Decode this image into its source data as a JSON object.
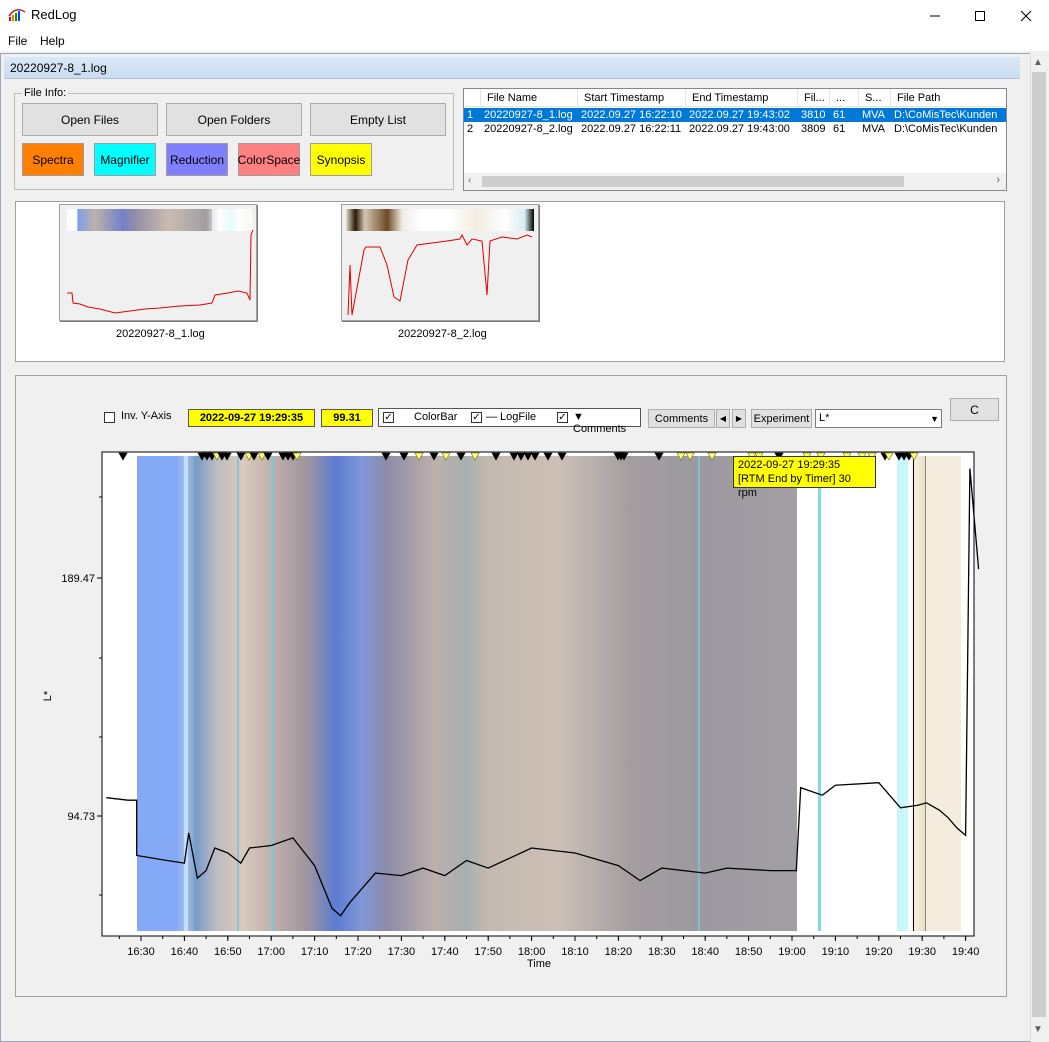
{
  "window": {
    "title": "RedLog",
    "minimize_icon": "minimize-icon",
    "maximize_icon": "maximize-icon",
    "close_icon": "close-icon"
  },
  "menu": {
    "file": "File",
    "help": "Help"
  },
  "document": {
    "title": "20220927-8_1.log"
  },
  "file_info": {
    "label": "File Info:",
    "open_files": "Open Files",
    "open_folders": "Open Folders",
    "empty_list": "Empty List"
  },
  "modes": [
    {
      "label": "Spectra",
      "color": "#ff7f00"
    },
    {
      "label": "Magnifier",
      "color": "#00ffff"
    },
    {
      "label": "Reduction",
      "color": "#8080ff"
    },
    {
      "label": "ColorSpace",
      "color": "#ff8080"
    },
    {
      "label": "Synopsis",
      "color": "#ffff00"
    }
  ],
  "file_list": {
    "columns": [
      "",
      "File Name",
      "Start Timestamp",
      "End Timestamp",
      "Fil...",
      "...",
      "S...",
      "File Path"
    ],
    "rows": [
      [
        "1",
        "20220927-8_1.log",
        "2022.09.27 16:22:10",
        "2022.09.27 19:43:02",
        "3810",
        "61",
        "MVA",
        "D:\\CoMisTec\\Kunden"
      ],
      [
        "2",
        "20220927-8_2.log",
        "2022.09.27 16:22:11",
        "2022.09.27 19:43:00",
        "3809",
        "61",
        "MVA",
        "D:\\CoMisTec\\Kunden"
      ]
    ],
    "selected_row": 0
  },
  "thumbnails": [
    {
      "label": "20220927-8_1.log"
    },
    {
      "label": "20220927-8_2.log"
    }
  ],
  "graph_controls": {
    "inv_y_axis": "Inv. Y-Axis",
    "inv_y_axis_checked": false,
    "cursor_time": "2022-09-27 19:29:35",
    "cursor_value": "99.31",
    "colorbar": "ColorBar",
    "colorbar_checked": true,
    "logfile": "— LogFile",
    "logfile_checked": true,
    "comments_opt": "▼ Comments",
    "comments_checked": true,
    "comments_button": "Comments",
    "experiment_button": "Experiment",
    "channel": "L*",
    "c_button": "C"
  },
  "tooltip": {
    "line1": "2022-09-27 19:29:35",
    "line2": "[RTM End by Timer] 30 rpm"
  },
  "chart_data": {
    "type": "line",
    "xlabel": "Time",
    "ylabel": "L*",
    "x_ticks": [
      "16:30",
      "16:40",
      "16:50",
      "17:00",
      "17:10",
      "17:20",
      "17:30",
      "17:40",
      "17:50",
      "18:00",
      "18:10",
      "18:20",
      "18:30",
      "18:40",
      "18:50",
      "19:00",
      "19:10",
      "19:20",
      "19:30",
      "19:40"
    ],
    "y_ticks": [
      "189.47",
      "94.73"
    ],
    "series": [
      {
        "color": "#000000",
        "points": [
          [
            "16:22",
            102
          ],
          [
            "16:27",
            101
          ],
          [
            "16:29",
            101
          ],
          [
            "16:29",
            79
          ],
          [
            "16:36",
            77
          ],
          [
            "16:40",
            76
          ],
          [
            "16:41",
            88
          ],
          [
            "16:43",
            70
          ],
          [
            "16:45",
            73
          ],
          [
            "16:47",
            82
          ],
          [
            "16:50",
            80
          ],
          [
            "16:53",
            76
          ],
          [
            "16:55",
            82
          ],
          [
            "17:00",
            83
          ],
          [
            "17:05",
            86
          ],
          [
            "17:10",
            75
          ],
          [
            "17:14",
            58
          ],
          [
            "17:16",
            55
          ],
          [
            "17:18",
            60
          ],
          [
            "17:24",
            72
          ],
          [
            "17:30",
            71
          ],
          [
            "17:35",
            74
          ],
          [
            "17:40",
            71
          ],
          [
            "17:45",
            77
          ],
          [
            "17:50",
            74
          ],
          [
            "18:00",
            82
          ],
          [
            "18:10",
            80
          ],
          [
            "18:20",
            75
          ],
          [
            "18:25",
            69
          ],
          [
            "18:30",
            74
          ],
          [
            "18:40",
            72
          ],
          [
            "18:45",
            74
          ],
          [
            "18:55",
            73
          ],
          [
            "19:01",
            73
          ],
          [
            "19:02",
            106
          ],
          [
            "19:07",
            103
          ],
          [
            "19:10",
            107
          ],
          [
            "19:20",
            108
          ],
          [
            "19:25",
            98
          ],
          [
            "19:29",
            99
          ],
          [
            "19:31",
            100
          ],
          [
            "19:34",
            97
          ],
          [
            "19:36",
            94
          ],
          [
            "19:38",
            90
          ],
          [
            "19:40",
            87
          ],
          [
            "19:41",
            233
          ],
          [
            "19:43",
            193
          ]
        ]
      }
    ]
  }
}
